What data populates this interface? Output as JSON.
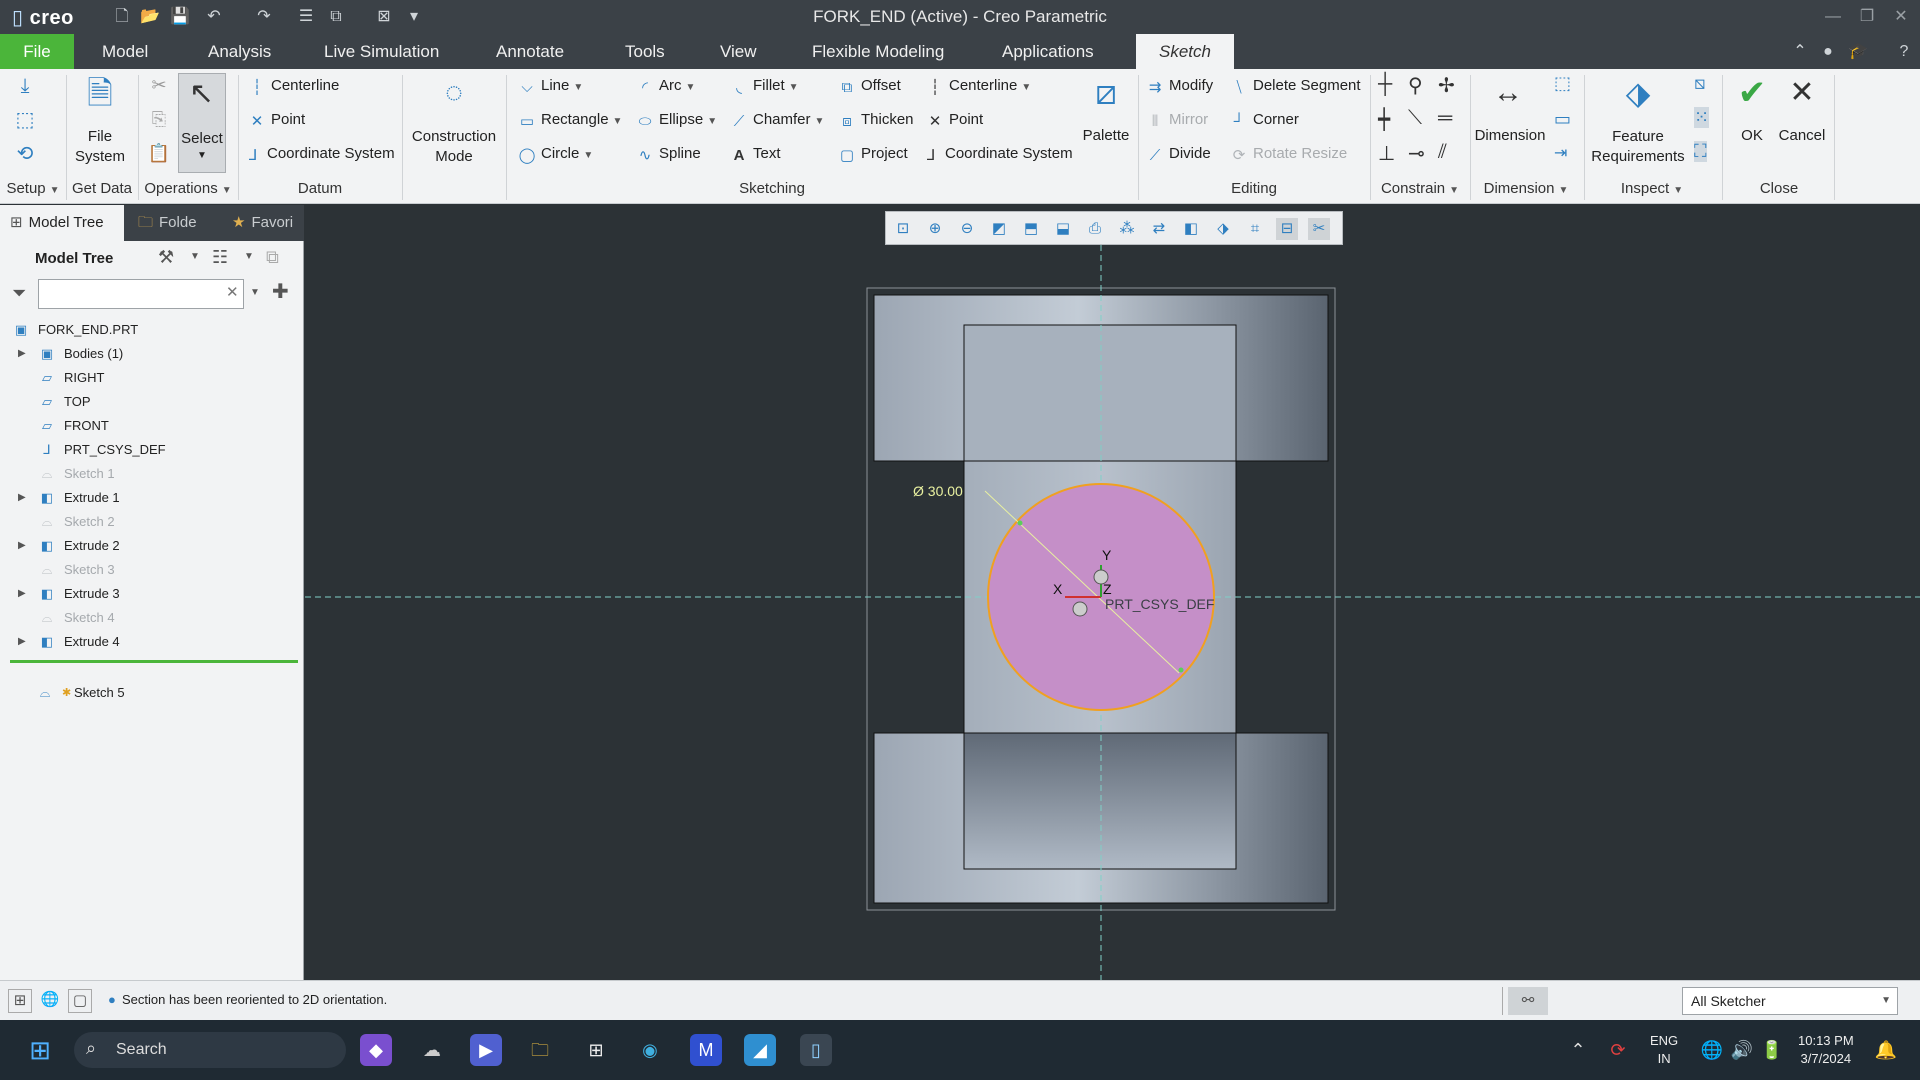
{
  "app": {
    "logo": "creo",
    "title": "FORK_END (Active) - Creo Parametric"
  },
  "menu": {
    "file": "File",
    "items": [
      "Model",
      "Analysis",
      "Live Simulation",
      "Annotate",
      "Tools",
      "View",
      "Flexible Modeling",
      "Applications",
      "Sketch"
    ]
  },
  "ribbon": {
    "groups": {
      "setup": "Setup",
      "get_data": "Get Data",
      "operations": "Operations",
      "datum": "Datum",
      "sketching": "Sketching",
      "editing": "Editing",
      "constrain": "Constrain",
      "dimension": "Dimension",
      "inspect": "Inspect",
      "close": "Close"
    },
    "get_data": {
      "file_system": "File\nSystem"
    },
    "operations": {
      "select": "Select"
    },
    "datum": {
      "centerline": "Centerline",
      "point": "Point",
      "csys": "Coordinate System"
    },
    "construction": "Construction\nMode",
    "sketching": {
      "line": "Line",
      "rectangle": "Rectangle",
      "circle": "Circle",
      "arc": "Arc",
      "ellipse": "Ellipse",
      "spline": "Spline",
      "fillet": "Fillet",
      "chamfer": "Chamfer",
      "text": "Text",
      "offset": "Offset",
      "thicken": "Thicken",
      "project": "Project",
      "centerline": "Centerline",
      "point": "Point",
      "csys": "Coordinate System",
      "palette": "Palette"
    },
    "editing": {
      "modify": "Modify",
      "mirror": "Mirror",
      "divide": "Divide",
      "delete_segment": "Delete Segment",
      "corner": "Corner",
      "rotate_resize": "Rotate Resize"
    },
    "dimension": {
      "label": "Dimension"
    },
    "inspect": {
      "feature_requirements": "Feature\nRequirements"
    },
    "close": {
      "ok": "OK",
      "cancel": "Cancel"
    }
  },
  "left_panel": {
    "tabs": [
      "Model Tree",
      "Folde",
      "Favori"
    ],
    "header": "Model Tree",
    "search": {
      "value": "",
      "placeholder": ""
    },
    "root": "FORK_END.PRT",
    "items": [
      {
        "label": "Bodies (1)",
        "expand": true,
        "dim": false,
        "icon": "body-icon"
      },
      {
        "label": "RIGHT",
        "expand": false,
        "dim": false,
        "icon": "datum-plane-icon"
      },
      {
        "label": "TOP",
        "expand": false,
        "dim": false,
        "icon": "datum-plane-icon"
      },
      {
        "label": "FRONT",
        "expand": false,
        "dim": false,
        "icon": "datum-plane-icon"
      },
      {
        "label": "PRT_CSYS_DEF",
        "expand": false,
        "dim": false,
        "icon": "csys-icon"
      },
      {
        "label": "Sketch 1",
        "expand": false,
        "dim": true,
        "icon": "sketch-icon"
      },
      {
        "label": "Extrude 1",
        "expand": true,
        "dim": false,
        "icon": "extrude-icon"
      },
      {
        "label": "Sketch 2",
        "expand": false,
        "dim": true,
        "icon": "sketch-icon"
      },
      {
        "label": "Extrude 2",
        "expand": true,
        "dim": false,
        "icon": "extrude-icon"
      },
      {
        "label": "Sketch 3",
        "expand": false,
        "dim": true,
        "icon": "sketch-icon"
      },
      {
        "label": "Extrude 3",
        "expand": true,
        "dim": false,
        "icon": "extrude-icon"
      },
      {
        "label": "Sketch 4",
        "expand": false,
        "dim": true,
        "icon": "sketch-icon"
      },
      {
        "label": "Extrude 4",
        "expand": true,
        "dim": false,
        "icon": "extrude-icon"
      }
    ],
    "active_sketch": "Sketch 5"
  },
  "canvas": {
    "dimension_label": "Ø 30.00",
    "axis_x": "X",
    "axis_y": "Y",
    "axis_z": "Z",
    "csys_label": "PRT_CSYS_DEF"
  },
  "status": {
    "message": "Section has been reoriented to 2D orientation.",
    "filter": "All Sketcher"
  },
  "taskbar": {
    "search": "Search",
    "lang_top": "ENG",
    "lang_bottom": "IN",
    "time": "10:13 PM",
    "date": "3/7/2024"
  },
  "colors": {
    "accent": "#4bb53a",
    "sketch_fill": "#c58fc8",
    "sketch_stroke": "#f0a020",
    "canvas_bg": "#2c3236",
    "centerline": "#7fd0c8"
  }
}
